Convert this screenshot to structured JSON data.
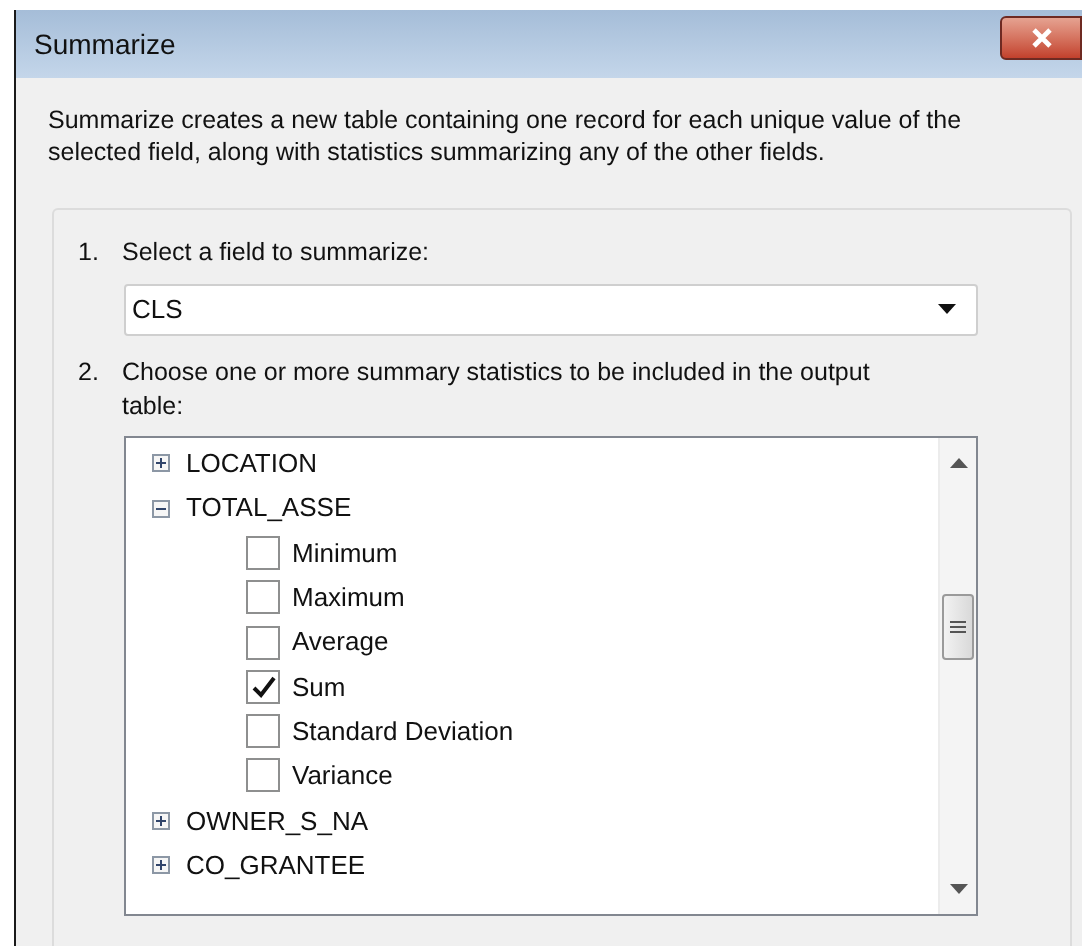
{
  "window": {
    "title": "Summarize"
  },
  "description": "Summarize creates a new table containing one record for each unique value of the selected field, along with statistics summarizing any of the other fields.",
  "step1": {
    "number": "1.",
    "label": "Select a field to summarize:",
    "value": "CLS"
  },
  "step2": {
    "number": "2.",
    "label": "Choose one or more summary statistics to be included in the output table:"
  },
  "tree": [
    {
      "label": "LOCATION",
      "expanded": false
    },
    {
      "label": "TOTAL_ASSE",
      "expanded": true,
      "children": [
        {
          "label": "Minimum",
          "checked": false
        },
        {
          "label": "Maximum",
          "checked": false
        },
        {
          "label": "Average",
          "checked": false
        },
        {
          "label": "Sum",
          "checked": true
        },
        {
          "label": "Standard Deviation",
          "checked": false
        },
        {
          "label": "Variance",
          "checked": false
        }
      ]
    },
    {
      "label": "OWNER_S_NA",
      "expanded": false
    },
    {
      "label": "CO_GRANTEE",
      "expanded": false
    }
  ]
}
